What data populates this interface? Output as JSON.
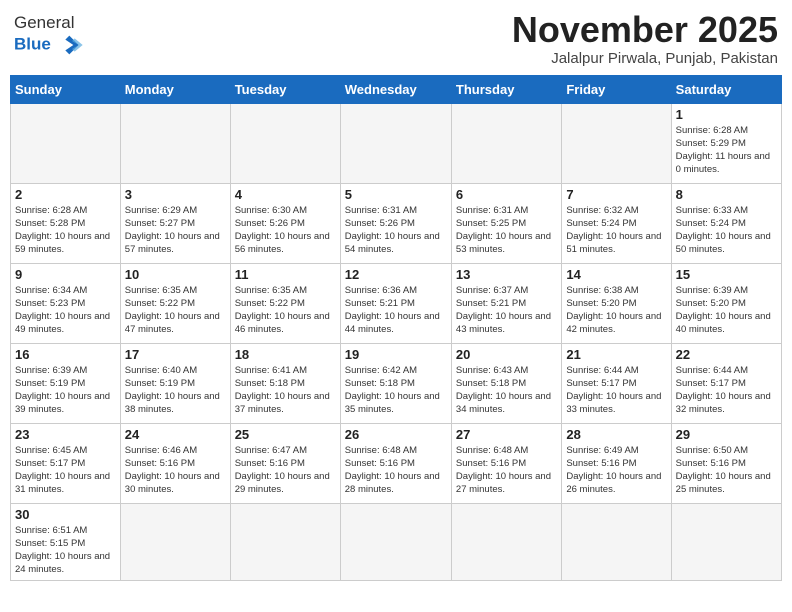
{
  "logo": {
    "text_general": "General",
    "text_blue": "Blue"
  },
  "title": "November 2025",
  "subtitle": "Jalalpur Pirwala, Punjab, Pakistan",
  "weekdays": [
    "Sunday",
    "Monday",
    "Tuesday",
    "Wednesday",
    "Thursday",
    "Friday",
    "Saturday"
  ],
  "weeks": [
    [
      {
        "day": "",
        "info": ""
      },
      {
        "day": "",
        "info": ""
      },
      {
        "day": "",
        "info": ""
      },
      {
        "day": "",
        "info": ""
      },
      {
        "day": "",
        "info": ""
      },
      {
        "day": "",
        "info": ""
      },
      {
        "day": "1",
        "info": "Sunrise: 6:28 AM\nSunset: 5:29 PM\nDaylight: 11 hours and 0 minutes."
      }
    ],
    [
      {
        "day": "2",
        "info": "Sunrise: 6:28 AM\nSunset: 5:28 PM\nDaylight: 10 hours and 59 minutes."
      },
      {
        "day": "3",
        "info": "Sunrise: 6:29 AM\nSunset: 5:27 PM\nDaylight: 10 hours and 57 minutes."
      },
      {
        "day": "4",
        "info": "Sunrise: 6:30 AM\nSunset: 5:26 PM\nDaylight: 10 hours and 56 minutes."
      },
      {
        "day": "5",
        "info": "Sunrise: 6:31 AM\nSunset: 5:26 PM\nDaylight: 10 hours and 54 minutes."
      },
      {
        "day": "6",
        "info": "Sunrise: 6:31 AM\nSunset: 5:25 PM\nDaylight: 10 hours and 53 minutes."
      },
      {
        "day": "7",
        "info": "Sunrise: 6:32 AM\nSunset: 5:24 PM\nDaylight: 10 hours and 51 minutes."
      },
      {
        "day": "8",
        "info": "Sunrise: 6:33 AM\nSunset: 5:24 PM\nDaylight: 10 hours and 50 minutes."
      }
    ],
    [
      {
        "day": "9",
        "info": "Sunrise: 6:34 AM\nSunset: 5:23 PM\nDaylight: 10 hours and 49 minutes."
      },
      {
        "day": "10",
        "info": "Sunrise: 6:35 AM\nSunset: 5:22 PM\nDaylight: 10 hours and 47 minutes."
      },
      {
        "day": "11",
        "info": "Sunrise: 6:35 AM\nSunset: 5:22 PM\nDaylight: 10 hours and 46 minutes."
      },
      {
        "day": "12",
        "info": "Sunrise: 6:36 AM\nSunset: 5:21 PM\nDaylight: 10 hours and 44 minutes."
      },
      {
        "day": "13",
        "info": "Sunrise: 6:37 AM\nSunset: 5:21 PM\nDaylight: 10 hours and 43 minutes."
      },
      {
        "day": "14",
        "info": "Sunrise: 6:38 AM\nSunset: 5:20 PM\nDaylight: 10 hours and 42 minutes."
      },
      {
        "day": "15",
        "info": "Sunrise: 6:39 AM\nSunset: 5:20 PM\nDaylight: 10 hours and 40 minutes."
      }
    ],
    [
      {
        "day": "16",
        "info": "Sunrise: 6:39 AM\nSunset: 5:19 PM\nDaylight: 10 hours and 39 minutes."
      },
      {
        "day": "17",
        "info": "Sunrise: 6:40 AM\nSunset: 5:19 PM\nDaylight: 10 hours and 38 minutes."
      },
      {
        "day": "18",
        "info": "Sunrise: 6:41 AM\nSunset: 5:18 PM\nDaylight: 10 hours and 37 minutes."
      },
      {
        "day": "19",
        "info": "Sunrise: 6:42 AM\nSunset: 5:18 PM\nDaylight: 10 hours and 35 minutes."
      },
      {
        "day": "20",
        "info": "Sunrise: 6:43 AM\nSunset: 5:18 PM\nDaylight: 10 hours and 34 minutes."
      },
      {
        "day": "21",
        "info": "Sunrise: 6:44 AM\nSunset: 5:17 PM\nDaylight: 10 hours and 33 minutes."
      },
      {
        "day": "22",
        "info": "Sunrise: 6:44 AM\nSunset: 5:17 PM\nDaylight: 10 hours and 32 minutes."
      }
    ],
    [
      {
        "day": "23",
        "info": "Sunrise: 6:45 AM\nSunset: 5:17 PM\nDaylight: 10 hours and 31 minutes."
      },
      {
        "day": "24",
        "info": "Sunrise: 6:46 AM\nSunset: 5:16 PM\nDaylight: 10 hours and 30 minutes."
      },
      {
        "day": "25",
        "info": "Sunrise: 6:47 AM\nSunset: 5:16 PM\nDaylight: 10 hours and 29 minutes."
      },
      {
        "day": "26",
        "info": "Sunrise: 6:48 AM\nSunset: 5:16 PM\nDaylight: 10 hours and 28 minutes."
      },
      {
        "day": "27",
        "info": "Sunrise: 6:48 AM\nSunset: 5:16 PM\nDaylight: 10 hours and 27 minutes."
      },
      {
        "day": "28",
        "info": "Sunrise: 6:49 AM\nSunset: 5:16 PM\nDaylight: 10 hours and 26 minutes."
      },
      {
        "day": "29",
        "info": "Sunrise: 6:50 AM\nSunset: 5:16 PM\nDaylight: 10 hours and 25 minutes."
      }
    ],
    [
      {
        "day": "30",
        "info": "Sunrise: 6:51 AM\nSunset: 5:15 PM\nDaylight: 10 hours and 24 minutes."
      },
      {
        "day": "",
        "info": ""
      },
      {
        "day": "",
        "info": ""
      },
      {
        "day": "",
        "info": ""
      },
      {
        "day": "",
        "info": ""
      },
      {
        "day": "",
        "info": ""
      },
      {
        "day": "",
        "info": ""
      }
    ]
  ]
}
